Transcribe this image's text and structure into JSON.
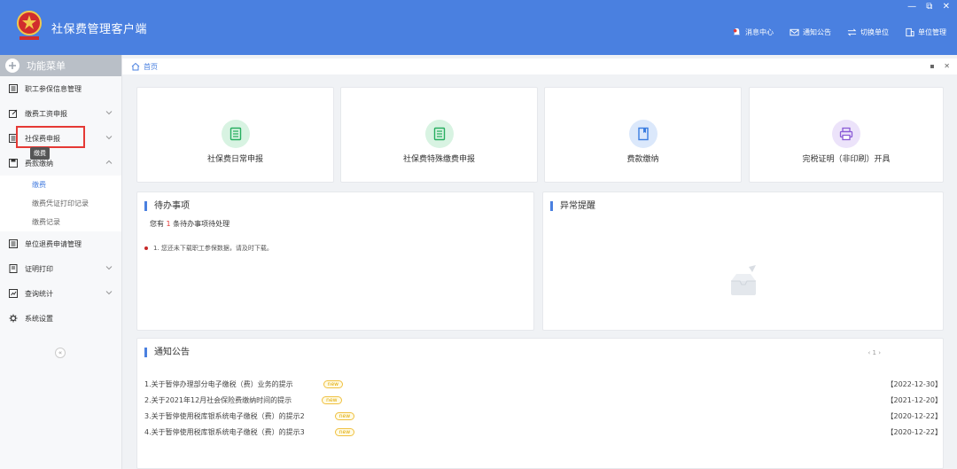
{
  "header": {
    "title": "社保费管理客户端",
    "window_controls": [
      "—",
      "⧉",
      "✕"
    ],
    "menu": [
      {
        "label": "消息中心",
        "icon": "bell-icon"
      },
      {
        "label": "通知公告",
        "icon": "mail-icon"
      },
      {
        "label": "切换单位",
        "icon": "switch-icon"
      },
      {
        "label": "单位管理",
        "icon": "building-icon"
      }
    ]
  },
  "sidebar": {
    "title": "功能菜单",
    "items": [
      {
        "label": "职工参保信息管理",
        "icon": "list-icon",
        "has_arrow": false
      },
      {
        "label": "缴费工资申报",
        "icon": "edit-icon",
        "has_arrow": true
      },
      {
        "label": "社保费申报",
        "icon": "list-icon",
        "has_arrow": true
      },
      {
        "label": "费款缴纳",
        "icon": "save-icon",
        "has_arrow": true,
        "expanded": true
      }
    ],
    "submenu": [
      {
        "label": "缴费",
        "active": true
      },
      {
        "label": "缴费凭证打印记录",
        "active": false
      },
      {
        "label": "缴费记录",
        "active": false
      }
    ],
    "items2": [
      {
        "label": "单位退费申请管理",
        "icon": "list-icon",
        "has_arrow": false
      },
      {
        "label": "证明打印",
        "icon": "doc-icon",
        "has_arrow": true
      },
      {
        "label": "查询统计",
        "icon": "chart-icon",
        "has_arrow": true
      },
      {
        "label": "系统设置",
        "icon": "gear-icon",
        "has_arrow": false
      }
    ],
    "tooltip": "缴费",
    "collapse": "«"
  },
  "breadcrumb": {
    "home": "首页",
    "icons": [
      "▪",
      "✕"
    ]
  },
  "quick_cards": [
    {
      "label": "社保费日常申报",
      "icon": "doc-green-icon",
      "color": "#27ae60",
      "bg": "#d8f3e2"
    },
    {
      "label": "社保费特殊缴费申报",
      "icon": "doc-green-icon",
      "color": "#27ae60",
      "bg": "#d8f3e2"
    },
    {
      "label": "费款缴纳",
      "icon": "book-blue-icon",
      "color": "#3b7de0",
      "bg": "#dbe8fb"
    },
    {
      "label": "完税证明（非印刷）开具",
      "icon": "printer-purple-icon",
      "color": "#8a5cd6",
      "bg": "#ece3fa"
    }
  ],
  "todo": {
    "title": "待办事项",
    "prefix": "您有 ",
    "count": "1",
    "suffix": " 条待办事项待处理",
    "items": [
      "1. 您还未下载职工参保数据，请及时下载。"
    ]
  },
  "alerts": {
    "title": "异常提醒"
  },
  "notices": {
    "title": "通知公告",
    "pager": "‹ 1 ›",
    "rows": [
      {
        "text": "1.关于暂停办理部分电子缴税（费）业务的提示",
        "badge": "new",
        "date": "【2022-12-30】"
      },
      {
        "text": "2.关于2021年12月社会保险费缴纳时间的提示",
        "badge": "new",
        "date": "【2021-12-20】"
      },
      {
        "text": "3.关于暂停使用税库银系统电子缴税（费）的提示2",
        "badge": "new",
        "date": "【2020-12-22】"
      },
      {
        "text": "4.关于暂停使用税库银系统电子缴税（费）的提示3",
        "badge": "new",
        "date": "【2020-12-22】"
      }
    ]
  }
}
